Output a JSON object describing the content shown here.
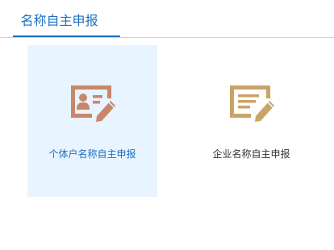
{
  "tabs": {
    "active_label": "名称自主申报"
  },
  "cards": {
    "individual": {
      "label": "个体户名称自主申报",
      "icon": "id-card-pen-icon",
      "icon_color": "#c8876a"
    },
    "enterprise": {
      "label": "企业名称自主申报",
      "icon": "document-pen-icon",
      "icon_color": "#c9a468"
    }
  },
  "colors": {
    "accent": "#1e6fc0",
    "selected_card_bg": "#e8f4ff"
  }
}
